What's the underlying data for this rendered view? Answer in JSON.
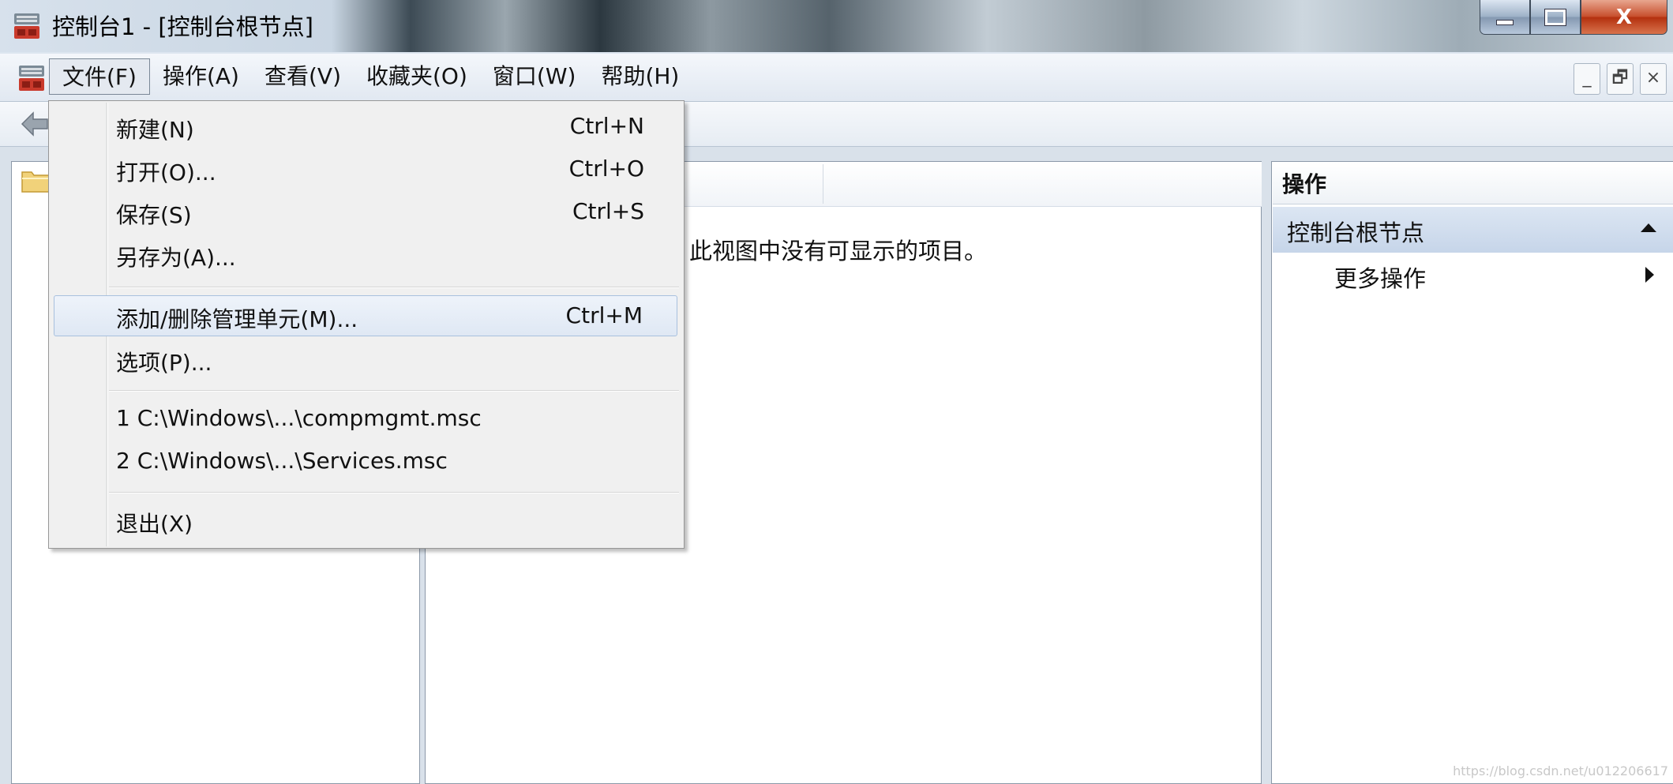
{
  "window": {
    "title": "控制台1 - [控制台根节点]",
    "minimize_glyph": "",
    "restore_glyph": "",
    "close_glyph": "X"
  },
  "menubar": {
    "items": [
      "文件(F)",
      "操作(A)",
      "查看(V)",
      "收藏夹(O)",
      "窗口(W)",
      "帮助(H)"
    ],
    "active_item": "文件(F)"
  },
  "mdi_buttons": {
    "minimize": "_",
    "restore": "🗗",
    "close": "×"
  },
  "file_menu": {
    "items": [
      {
        "label": "新建(N)",
        "shortcut": "Ctrl+N"
      },
      {
        "label": "打开(O)...",
        "shortcut": "Ctrl+O"
      },
      {
        "label": "保存(S)",
        "shortcut": "Ctrl+S"
      },
      {
        "label": "另存为(A)...",
        "shortcut": ""
      },
      {
        "label": "添加/删除管理单元(M)...",
        "shortcut": "Ctrl+M",
        "highlighted": true
      },
      {
        "label": "选项(P)...",
        "shortcut": ""
      },
      {
        "label": "1 C:\\Windows\\...\\compmgmt.msc",
        "shortcut": ""
      },
      {
        "label": "2 C:\\Windows\\...\\Services.msc",
        "shortcut": ""
      },
      {
        "label": "退出(X)",
        "shortcut": ""
      }
    ]
  },
  "center_pane": {
    "empty_message": "此视图中没有可显示的项目。"
  },
  "actions_pane": {
    "title": "操作",
    "section": "控制台根节点",
    "more": "更多操作"
  },
  "watermark": "https://blog.csdn.net/u012206617",
  "icons": {
    "app": "mmc-console-icon",
    "back": "back-arrow-icon",
    "folder": "folder-icon"
  },
  "colors": {
    "highlight": "#dfe8f4",
    "menu_bg": "#f0f0f0",
    "close_red": "#c8502e"
  }
}
